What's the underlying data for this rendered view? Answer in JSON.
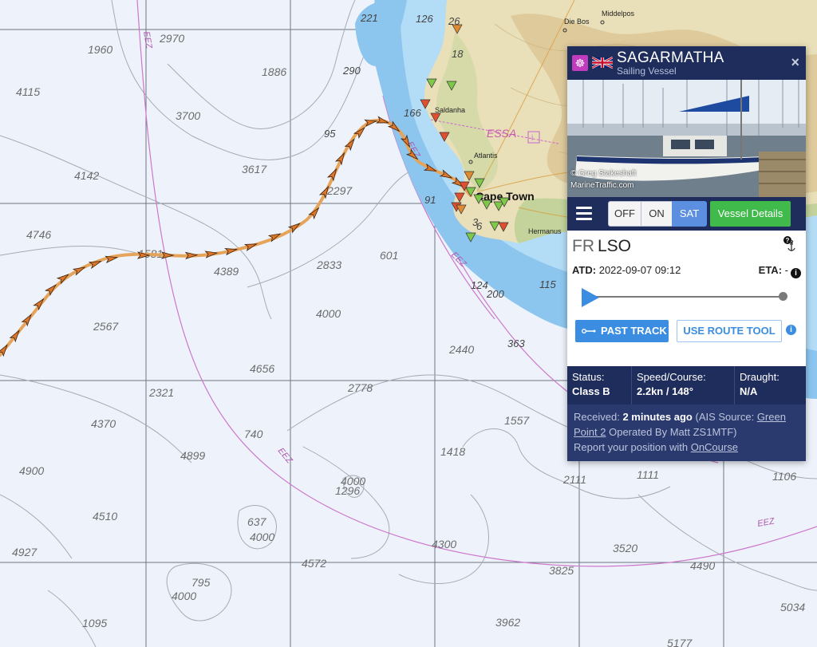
{
  "map": {
    "depth_labels": [
      "1960",
      "2970",
      "1886",
      "4115",
      "3700",
      "4142",
      "3617",
      "4746",
      "2297",
      "4389",
      "2833",
      "601",
      "2567",
      "4000",
      "2440",
      "4656",
      "2321",
      "2778",
      "1557",
      "4370",
      "740",
      "4899",
      "1418",
      "4900",
      "4000",
      "1296",
      "2111",
      "1111",
      "1106",
      "4510",
      "637",
      "4000",
      "4927",
      "4572",
      "4300",
      "3520",
      "3825",
      "4490",
      "795",
      "4000",
      "1095",
      "3962",
      "5034",
      "5177",
      "290",
      "95",
      "166",
      "91",
      "26",
      "18",
      "3",
      "6",
      "200",
      "124",
      "115",
      "363",
      "1581"
    ],
    "top_depths": [
      "221",
      "126"
    ],
    "towns": [
      "Die Bos",
      "Middelpos",
      "Saldanha",
      "Atlantis",
      "Cape Town",
      "Hermanus"
    ],
    "zone_labels": [
      "EEZ",
      "EEZ",
      "EEZ",
      "EEZ",
      "EEZ"
    ],
    "essa_label": "ESSA",
    "essa_box": "i",
    "colors": {
      "track": "#e39a4a",
      "eez": "#cc66cc",
      "shallow": "#a8d4f2",
      "deep_shelf": "#8cc4ee",
      "land": "#e8ddb5"
    }
  },
  "popup": {
    "vessel_name": "SAGARMATHA",
    "vessel_subtype": "Sailing Vessel",
    "type_icon": "ship-wheel-icon",
    "flag_icon": "uk-flag-icon",
    "close": "×",
    "photo_credit": "© Greg Stakeshaft",
    "photo_credit_site": "MarineTraffic.com",
    "toolbar": {
      "off": "OFF",
      "on": "ON",
      "sat": "SAT",
      "details": "Vessel Details"
    },
    "flag_code": "FR",
    "callsign": "LSO",
    "atd_label": "ATD:",
    "atd_value": "2022-09-07 09:12",
    "eta_label": "ETA:",
    "eta_value": "-",
    "past_track": "PAST TRACK",
    "route_tool": "USE ROUTE TOOL",
    "status_label": "Status:",
    "status_value": "Class B",
    "speed_label": "Speed/Course:",
    "speed_value": "2.2kn / 148°",
    "draught_label": "Draught:",
    "draught_value": "N/A",
    "received_prefix": "Received:",
    "received_time": "2 minutes ago",
    "ais_prefix": "(AIS Source:",
    "ais_source": "Green Point 2",
    "operated_by": "Operated By Matt ZS1MTF)",
    "report_prefix": "Report your position with",
    "report_link": "OnCourse"
  }
}
